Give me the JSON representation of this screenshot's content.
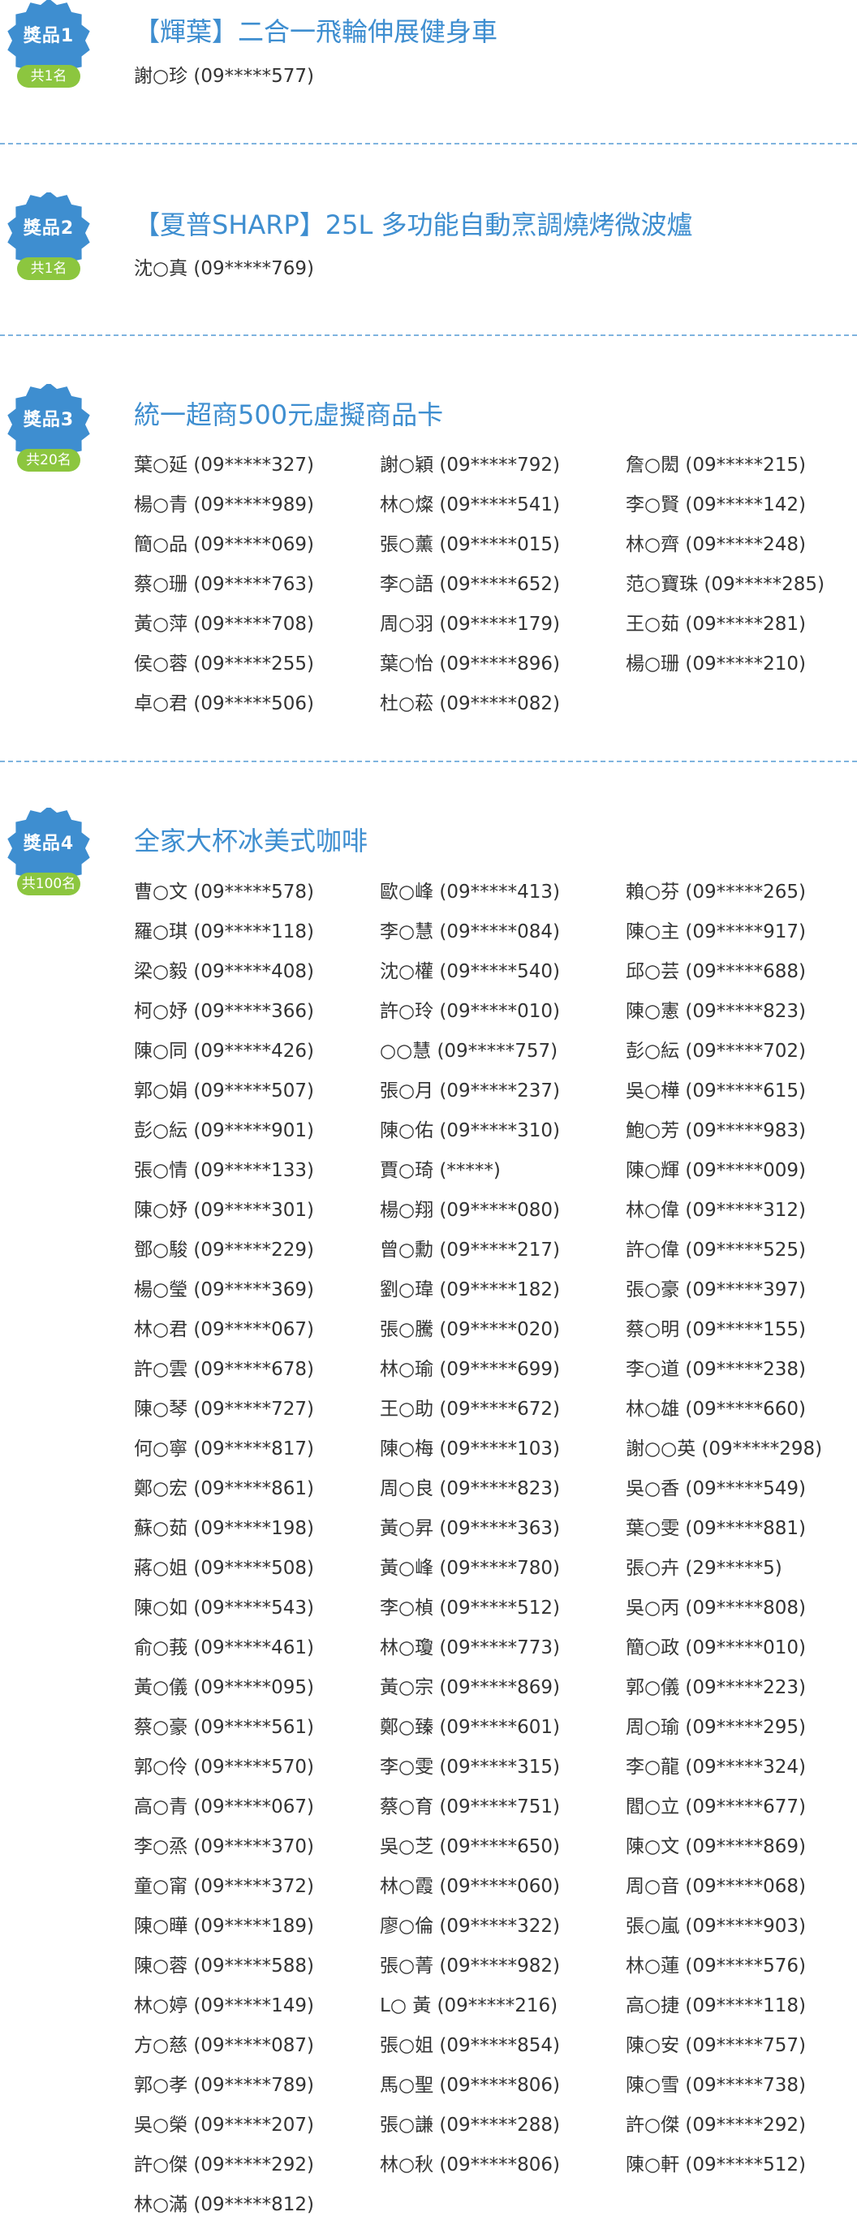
{
  "colors": {
    "badge": "#3e8ed0",
    "count_pill": "#8cc63f",
    "title": "#3e8ed0",
    "divider": "#7fb4df"
  },
  "prizes": [
    {
      "badge": "獎品1",
      "count": "共1名",
      "title": "【輝葉】二合一飛輪伸展健身車",
      "winners": [
        "謝○珍 (09*****577)"
      ]
    },
    {
      "badge": "獎品2",
      "count": "共1名",
      "title": "【夏普SHARP】25L 多功能自動烹調燒烤微波爐",
      "winners": [
        "沈○真 (09*****769)"
      ]
    },
    {
      "badge": "獎品3",
      "count": "共20名",
      "title": "統一超商500元虛擬商品卡",
      "winners": [
        "葉○延 (09*****327)",
        "謝○穎 (09*****792)",
        "詹○閎 (09*****215)",
        "楊○青 (09*****989)",
        "林○燦 (09*****541)",
        "李○賢 (09*****142)",
        "簡○品 (09*****069)",
        "張○薰 (09*****015)",
        "林○齊 (09*****248)",
        "蔡○珊 (09*****763)",
        "李○語 (09*****652)",
        "范○寶珠 (09*****285)",
        "黃○萍 (09*****708)",
        "周○羽 (09*****179)",
        "王○茹 (09*****281)",
        "侯○蓉 (09*****255)",
        "葉○怡 (09*****896)",
        "楊○珊 (09*****210)",
        "卓○君 (09*****506)",
        "杜○菘 (09*****082)"
      ]
    },
    {
      "badge": "獎品4",
      "count": "共100名",
      "title": "全家大杯冰美式咖啡",
      "winners": [
        "曹○文 (09*****578)",
        "歐○峰 (09*****413)",
        "賴○芬 (09*****265)",
        "羅○琪 (09*****118)",
        "李○慧 (09*****084)",
        "陳○主 (09*****917)",
        " 梁○毅 (09*****408)",
        "沈○權 (09*****540)",
        "邱○芸 (09*****688)",
        "柯○妤 (09*****366)",
        "許○玲 (09*****010)",
        "陳○憲 (09*****823)",
        "陳○同 (09*****426)",
        "○○慧 (09*****757)",
        "彭○紜 (09*****702)",
        "郭○娟 (09*****507)",
        "張○月 (09*****237)",
        "吳○樺 (09*****615)",
        "彭○紜 (09*****901)",
        "陳○佑 (09*****310)",
        "鮑○芳 (09*****983)",
        "張○情 (09*****133)",
        "賈○琦 (*****)",
        "陳○輝 (09*****009)",
        "陳○妤 (09*****301)",
        "楊○翔 (09*****080)",
        "林○偉 (09*****312)",
        "鄧○駿 (09*****229)",
        "曾○勳 (09*****217)",
        "許○偉 (09*****525)",
        "楊○瑩 (09*****369)",
        "劉○瑋 (09*****182)",
        "張○豪 (09*****397)",
        "林○君 (09*****067)",
        "張○騰 (09*****020)",
        "蔡○明 (09*****155)",
        "許○雲 (09*****678)",
        "林○瑜 (09*****699)",
        "李○道 (09*****238)",
        "陳○琴 (09*****727)",
        "王○助 (09*****672)",
        "林○雄 (09*****660)",
        "何○寧 (09*****817)",
        "陳○梅 (09*****103)",
        "謝○○英 (09*****298)",
        "鄭○宏 (09*****861)",
        "周○良 (09*****823)",
        "吳○香 (09*****549)",
        "蘇○茹 (09*****198)",
        "黃○昇 (09*****363)",
        "葉○雯 (09*****881)",
        "蔣○姐 (09*****508)",
        "黃○峰 (09*****780)",
        "張○卉 (29*****5)",
        "陳○如 (09*****543)",
        "李○楨 (09*****512)",
        "吳○丙 (09*****808)",
        "俞○莪 (09*****461)",
        "林○瓊 (09*****773)",
        "簡○政 (09*****010)",
        "黃○儀 (09*****095)",
        "黃○宗 (09*****869)",
        "郭○儀 (09*****223)",
        "蔡○豪 (09*****561)",
        "鄭○臻 (09*****601)",
        "周○瑜 (09*****295)",
        "郭○伶 (09*****570)",
        "李○雯 (09*****315)",
        "李○龍 (09*****324)",
        "高○青 (09*****067)",
        "蔡○育 (09*****751)",
        "閻○立 (09*****677)",
        "李○烝 (09*****370)",
        "吳○芝 (09*****650)",
        "陳○文 (09*****869)",
        "童○甯 (09*****372)",
        "林○霞 (09*****060)",
        "周○音 (09*****068)",
        "陳○曄 (09*****189)",
        "廖○倫 (09*****322)",
        "張○嵐 (09*****903)",
        "陳○蓉 (09*****588)",
        "張○菁 (09*****982)",
        "林○蓮 (09*****576)",
        "林○婷 (09*****149)",
        "L○ 黃 (09*****216)",
        "高○捷 (09*****118)",
        "方○慈 (09*****087)",
        "張○姐 (09*****854)",
        "陳○安 (09*****757)",
        "郭○孝 (09*****789)",
        "馬○聖 (09*****806)",
        "陳○雪 (09*****738)",
        "吳○榮 (09*****207)",
        "張○謙 (09*****288)",
        "許○傑 (09*****292)",
        "許○傑 (09*****292)",
        "林○秋 (09*****806)",
        "陳○軒 (09*****512)",
        "林○滿 (09*****812)"
      ]
    }
  ]
}
